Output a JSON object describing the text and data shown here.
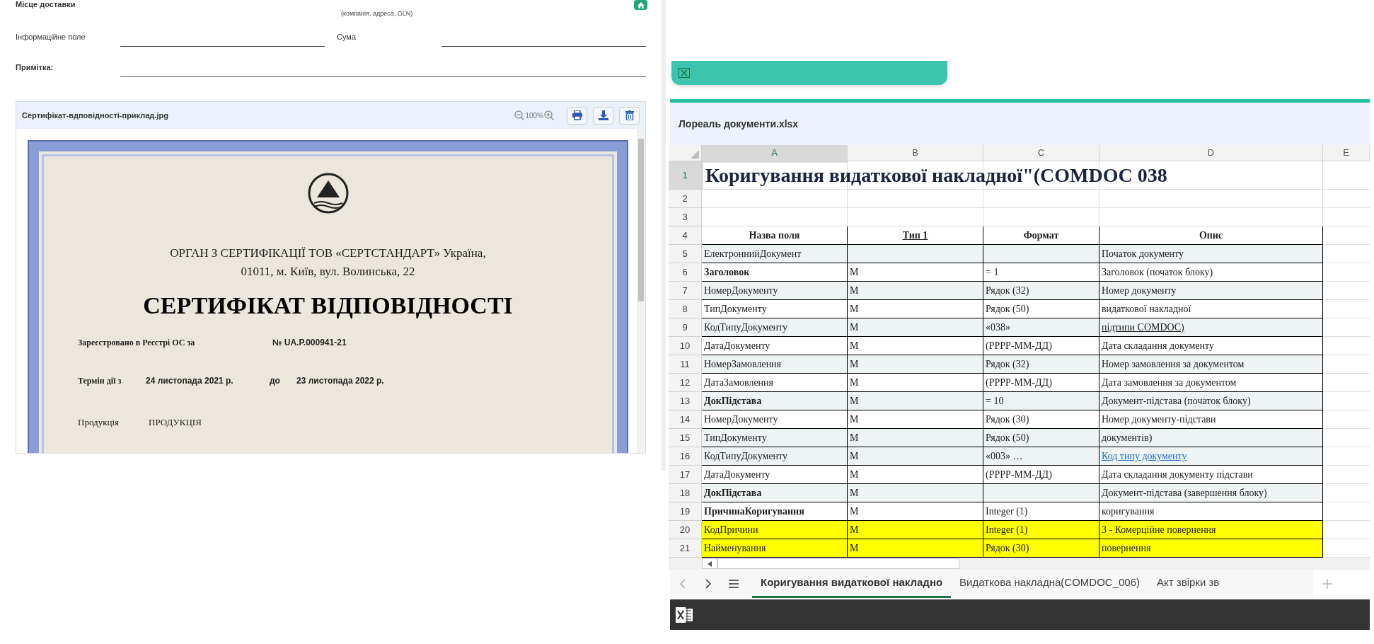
{
  "form": {
    "delivery_label": "Місце доставки",
    "delivery_hint": "(компанія, адреса, GLN)",
    "fields": [
      {
        "label": "Інформаційне поле"
      },
      {
        "label": "Сума"
      }
    ],
    "note_label": "Примітка:"
  },
  "viewer": {
    "file_name": "Сертифікат-вдповідності-приклад.jpg",
    "zoom": "100%",
    "document": {
      "issuer_line1": "ОРГАН З СЕРТИФІКАЦІЇ ТОВ «СЕРТСТАНДАРТ» Україна,",
      "issuer_line2": "01011, м. Київ, вул. Волинська, 22",
      "title": "СЕРТИФІКАТ ВІДПОВІДНОСТІ",
      "registered_label": "Зареєстровано в Реєстрі ОС  за",
      "registered_number": "№ UA.P.000941-21",
      "validity_label": "Термін дії з",
      "valid_from": "24 листопада 2021 р.",
      "to_label": "до",
      "valid_to": "23 листопада 2022 р.",
      "product_label": "Продукція",
      "product_value": "ПРОДУКЦІЯ"
    }
  },
  "spreadsheet": {
    "file_name": "Лореаль документи.xlsx",
    "columns": [
      {
        "label": "A",
        "selected": true
      },
      {
        "label": "B",
        "selected": false
      },
      {
        "label": "C",
        "selected": false
      },
      {
        "label": "D",
        "selected": false
      },
      {
        "label": "E",
        "selected": false
      }
    ],
    "rows": [
      {
        "number": "1",
        "selected": true,
        "kind": "title",
        "color": "#ffffff",
        "cells": [
          {
            "text": "Коригування видаткової накладної\"(COMDOC 038"
          },
          null,
          null,
          null
        ]
      },
      {
        "number": "2",
        "selected": false,
        "kind": "blank",
        "color": "#ffffff",
        "cells": [
          null,
          null,
          null,
          null
        ]
      },
      {
        "number": "3",
        "selected": false,
        "kind": "blank",
        "color": "#ffffff",
        "cells": [
          null,
          null,
          null,
          null
        ]
      },
      {
        "number": "4",
        "selected": false,
        "kind": "header",
        "color": "#ffffff",
        "cells": [
          {
            "text": "Назва поля"
          },
          {
            "text": "Тип 1",
            "kind": "underline"
          },
          {
            "text": "Формат"
          },
          {
            "text": "Опис"
          }
        ]
      },
      {
        "number": "5",
        "selected": false,
        "kind": "field",
        "color": "#eef3f3",
        "cells": [
          {
            "text": "ЕлектроннийДокумент"
          },
          null,
          null,
          {
            "text": "Початок документу"
          }
        ]
      },
      {
        "number": "6",
        "selected": false,
        "kind": "group",
        "color": "#ffffff",
        "cells": [
          {
            "text": "Заголовок"
          },
          {
            "text": "M"
          },
          {
            "text": "= 1"
          },
          {
            "text": "Заголовок (початок блоку)"
          }
        ]
      },
      {
        "number": "7",
        "selected": false,
        "kind": "field",
        "color": "#eef3f3",
        "cells": [
          {
            "text": "НомерДокументу"
          },
          {
            "text": "M"
          },
          {
            "text": "Рядок (32)"
          },
          {
            "text": "Номер документу"
          }
        ]
      },
      {
        "number": "8",
        "selected": false,
        "kind": "field",
        "color": "#ffffff",
        "cells": [
          {
            "text": "ТипДокументу"
          },
          {
            "text": "M"
          },
          {
            "text": "Рядок (50)"
          },
          {
            "text": "видаткової накладної"
          }
        ]
      },
      {
        "number": "9",
        "selected": false,
        "kind": "field",
        "color": "#eef3f3",
        "cells": [
          {
            "text": "КодТипуДокументу"
          },
          {
            "text": "M"
          },
          {
            "text": "«038»"
          },
          {
            "text": "підтипи COMDOC)",
            "kind": "underline"
          }
        ]
      },
      {
        "number": "10",
        "selected": false,
        "kind": "field",
        "color": "#ffffff",
        "cells": [
          {
            "text": "ДатаДокументу"
          },
          {
            "text": "M"
          },
          {
            "text": "(РРРР-ММ-ДД)"
          },
          {
            "text": "Дата складання документу"
          }
        ]
      },
      {
        "number": "11",
        "selected": false,
        "kind": "field",
        "color": "#eef3f3",
        "cells": [
          {
            "text": "НомерЗамовлення"
          },
          {
            "text": "M"
          },
          {
            "text": "Рядок (32)"
          },
          {
            "text": "Номер замовлення за документом"
          }
        ]
      },
      {
        "number": "12",
        "selected": false,
        "kind": "field",
        "color": "#ffffff",
        "cells": [
          {
            "text": "ДатаЗамовлення"
          },
          {
            "text": "M"
          },
          {
            "text": "(РРРР-ММ-ДД)"
          },
          {
            "text": "Дата замовлення за документом"
          }
        ]
      },
      {
        "number": "13",
        "selected": false,
        "kind": "group",
        "color": "#eef3f3",
        "cells": [
          {
            "text": "ДокПідстава"
          },
          {
            "text": "M"
          },
          {
            "text": "= 10"
          },
          {
            "text": "Документ-підстава (початок блоку)"
          }
        ]
      },
      {
        "number": "14",
        "selected": false,
        "kind": "field",
        "color": "#ffffff",
        "cells": [
          {
            "text": "НомерДокументу"
          },
          {
            "text": "M"
          },
          {
            "text": "Рядок (30)"
          },
          {
            "text": "Номер документу-підстави"
          }
        ]
      },
      {
        "number": "15",
        "selected": false,
        "kind": "field",
        "color": "#eef3f3",
        "cells": [
          {
            "text": "ТипДокументу"
          },
          {
            "text": "M"
          },
          {
            "text": "Рядок (50)"
          },
          {
            "text": "документів)"
          }
        ]
      },
      {
        "number": "16",
        "selected": false,
        "kind": "field",
        "color": "#eef3f3",
        "cells": [
          {
            "text": "КодТипуДокументу"
          },
          {
            "text": "M"
          },
          {
            "text": "«003» …"
          },
          {
            "text": "Код типу документу",
            "kind": "link"
          }
        ]
      },
      {
        "number": "17",
        "selected": false,
        "kind": "field",
        "color": "#ffffff",
        "cells": [
          {
            "text": "ДатаДокументу"
          },
          {
            "text": "M"
          },
          {
            "text": "(РРРР-ММ-ДД)"
          },
          {
            "text": "Дата складання документу підстави"
          }
        ]
      },
      {
        "number": "18",
        "selected": false,
        "kind": "group",
        "color": "#eef3f3",
        "cells": [
          {
            "text": "ДокПідстава"
          },
          {
            "text": "M"
          },
          null,
          {
            "text": "Документ-підстава (завершення блоку)"
          }
        ]
      },
      {
        "number": "19",
        "selected": false,
        "kind": "group",
        "color": "#ffffff",
        "cells": [
          {
            "text": "ПричинаКоригування"
          },
          {
            "text": "M"
          },
          {
            "text": "Integer (1)"
          },
          {
            "text": "коригування"
          }
        ]
      },
      {
        "number": "20",
        "selected": false,
        "kind": "field",
        "color": "#ffff00",
        "cells": [
          {
            "text": "КодПричини"
          },
          {
            "text": "M"
          },
          {
            "text": "Integer (1)"
          },
          {
            "text": "3 - Комерційне повернення"
          }
        ]
      },
      {
        "number": "21",
        "selected": false,
        "kind": "field",
        "color": "#ffff00",
        "cells": [
          {
            "text": "Найменування"
          },
          {
            "text": "M"
          },
          {
            "text": "Рядок (30)"
          },
          {
            "text": "повернення"
          }
        ]
      }
    ],
    "sheet_tabs": [
      {
        "label": "Коригування видаткової накладно",
        "selected": true
      },
      {
        "label": "Видаткова накладна(COMDOC_006)",
        "selected": false
      },
      {
        "label": "Акт звірки зв",
        "selected": false
      }
    ]
  }
}
